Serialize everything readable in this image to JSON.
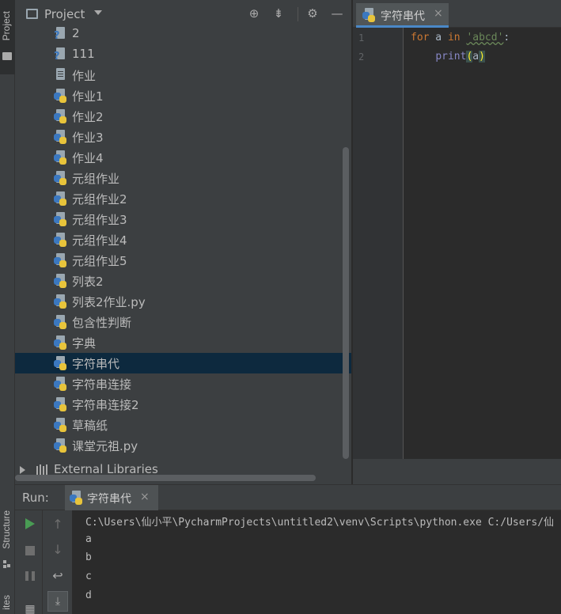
{
  "left_strip": {
    "project_tab": "Project",
    "structure_tab": "Structure",
    "favorites_tab": "ites"
  },
  "project_panel": {
    "title": "Project",
    "files": [
      {
        "name": "2",
        "icon": "unknown-file-icon"
      },
      {
        "name": "111",
        "icon": "unknown-file-icon"
      },
      {
        "name": "作业",
        "icon": "text-file-icon"
      },
      {
        "name": "作业1",
        "icon": "python-file-icon"
      },
      {
        "name": "作业2",
        "icon": "python-file-icon"
      },
      {
        "name": "作业3",
        "icon": "python-file-icon"
      },
      {
        "name": "作业4",
        "icon": "python-file-icon"
      },
      {
        "name": "元组作业",
        "icon": "python-file-icon"
      },
      {
        "name": "元组作业2",
        "icon": "python-file-icon"
      },
      {
        "name": "元组作业3",
        "icon": "python-file-icon"
      },
      {
        "name": "元组作业4",
        "icon": "python-file-icon"
      },
      {
        "name": "元组作业5",
        "icon": "python-file-icon"
      },
      {
        "name": "列表2",
        "icon": "python-file-icon"
      },
      {
        "name": "列表2作业.py",
        "icon": "python-file-icon"
      },
      {
        "name": "包含性判断",
        "icon": "python-file-icon"
      },
      {
        "name": "字典",
        "icon": "python-file-icon"
      },
      {
        "name": "字符串代",
        "icon": "python-file-icon",
        "selected": true
      },
      {
        "name": "字符串连接",
        "icon": "python-file-icon"
      },
      {
        "name": "字符串连接2",
        "icon": "python-file-icon"
      },
      {
        "name": "草稿纸",
        "icon": "python-file-icon"
      },
      {
        "name": "课堂元祖.py",
        "icon": "python-file-icon"
      }
    ],
    "external_libraries": "External Libraries"
  },
  "editor": {
    "tab_label": "字符串代",
    "tab_close": "×",
    "line_numbers": [
      "1",
      "2"
    ],
    "code": {
      "l1_kw_for": "for",
      "l1_var": " a ",
      "l1_kw_in": "in",
      "l1_space": " ",
      "l1_str": "'abcd'",
      "l1_colon": ":",
      "l2_indent": "    ",
      "l2_fn": "print",
      "l2_open": "(",
      "l2_arg": "a",
      "l2_close": ")"
    }
  },
  "run_panel": {
    "label": "Run:",
    "tab_label": "字符串代",
    "tab_close": "×",
    "output": [
      "C:\\Users\\仙小平\\PycharmProjects\\untitled2\\venv\\Scripts\\python.exe C:/Users/仙",
      "a",
      "b",
      "c",
      "d"
    ]
  },
  "colors": {
    "background": "#2b2b2b",
    "panel": "#3c3f41",
    "selection": "#0d293e",
    "keyword": "#cc7832",
    "string": "#6a8759",
    "builtin": "#8888c6",
    "run_green": "#499c54"
  }
}
